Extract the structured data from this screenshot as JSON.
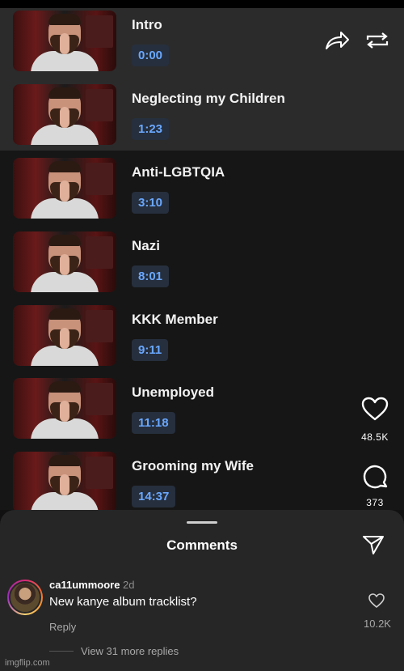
{
  "chapters": [
    {
      "title": "Intro",
      "time": "0:00"
    },
    {
      "title": "Neglecting my Children",
      "time": "1:23"
    },
    {
      "title": "Anti-LGBTQIA",
      "time": "3:10"
    },
    {
      "title": "Nazi",
      "time": "8:01"
    },
    {
      "title": "KKK Member",
      "time": "9:11"
    },
    {
      "title": "Unemployed",
      "time": "11:18"
    },
    {
      "title": "Grooming my Wife",
      "time": "14:37"
    }
  ],
  "actions": {
    "share_icon": "share-arrow-icon",
    "repeat_icon": "repeat-icon",
    "like_icon": "heart-icon",
    "like_count": "48.5K",
    "comment_icon": "comment-bubble-icon",
    "comment_count": "373"
  },
  "comments_sheet": {
    "title": "Comments",
    "send_icon": "send-icon",
    "comment": {
      "username": "ca11ummoore",
      "time_ago": "2d",
      "text": "New kanye album tracklist?",
      "reply_label": "Reply",
      "like_count": "10.2K"
    },
    "view_replies": "View 31 more replies"
  },
  "watermark": "imgflip.com",
  "colors": {
    "timestamp_text": "#6aa8ff",
    "timestamp_bg": "#262f3d",
    "sheet_bg": "#262626"
  }
}
